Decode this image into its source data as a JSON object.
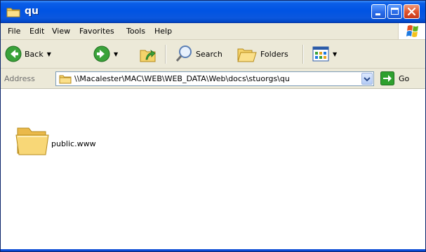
{
  "window": {
    "title": "qu",
    "title_icon": "folder-icon",
    "controls": {
      "minimize_icon": "minimize-icon",
      "maximize_icon": "maximize-icon",
      "close_icon": "close-icon"
    }
  },
  "menubar": {
    "items": [
      "File",
      "Edit",
      "View",
      "Favorites",
      "Tools",
      "Help"
    ],
    "logo_icon": "windows-logo-icon"
  },
  "toolbar": {
    "back_label": "Back",
    "search_label": "Search",
    "folders_label": "Folders",
    "icons": {
      "back": "back-arrow-icon",
      "forward": "forward-arrow-icon",
      "up": "up-folder-icon",
      "search": "search-icon",
      "folders": "folders-icon",
      "views": "views-icon"
    }
  },
  "addressbar": {
    "label": "Address",
    "value": "\\\\Macalester\\MAC\\WEB\\WEB_DATA\\Web\\docs\\stuorgs\\qu",
    "go_label": "Go"
  },
  "content": {
    "items": [
      {
        "name": "public.www",
        "icon": "folder-icon"
      }
    ]
  },
  "colors": {
    "titlebar": "#0054e3",
    "chrome": "#ece9d8",
    "close_button": "#e0552f",
    "go_arrow": "#2ea02e"
  }
}
